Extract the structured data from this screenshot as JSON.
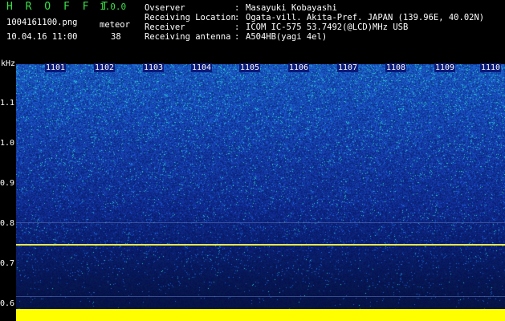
{
  "header": {
    "title": "H R O F F T",
    "version": "1.0.0",
    "filename": "1004161100.png",
    "datetime": "10.04.16 11:00",
    "meteor_label": "meteor",
    "meteor_count": "38",
    "info": [
      {
        "key": "Ovserver",
        "value": "Masayuki Kobayashi"
      },
      {
        "key": "Receiving Location",
        "value": "Ogata-vill. Akita-Pref. JAPAN (139.96E, 40.02N)"
      },
      {
        "key": "Receiver",
        "value": "ICOM IC-575 53.7492(@LCD)MHz USB"
      },
      {
        "key": "Receiving antenna",
        "value": "A504HB(yagi 4el)"
      }
    ]
  },
  "axes": {
    "y_unit": "kHz",
    "y_ticks": [
      "1.1",
      "1.0",
      "0.9",
      "0.8",
      "0.7",
      "0.6"
    ],
    "x_ticks": [
      "1101",
      "1102",
      "1103",
      "1104",
      "1105",
      "1106",
      "1107",
      "1108",
      "1109",
      "1110"
    ]
  },
  "colors": {
    "carrier": "#e8e84a",
    "bottom_bar": "#ffff00",
    "title_green": "#39e047"
  }
}
